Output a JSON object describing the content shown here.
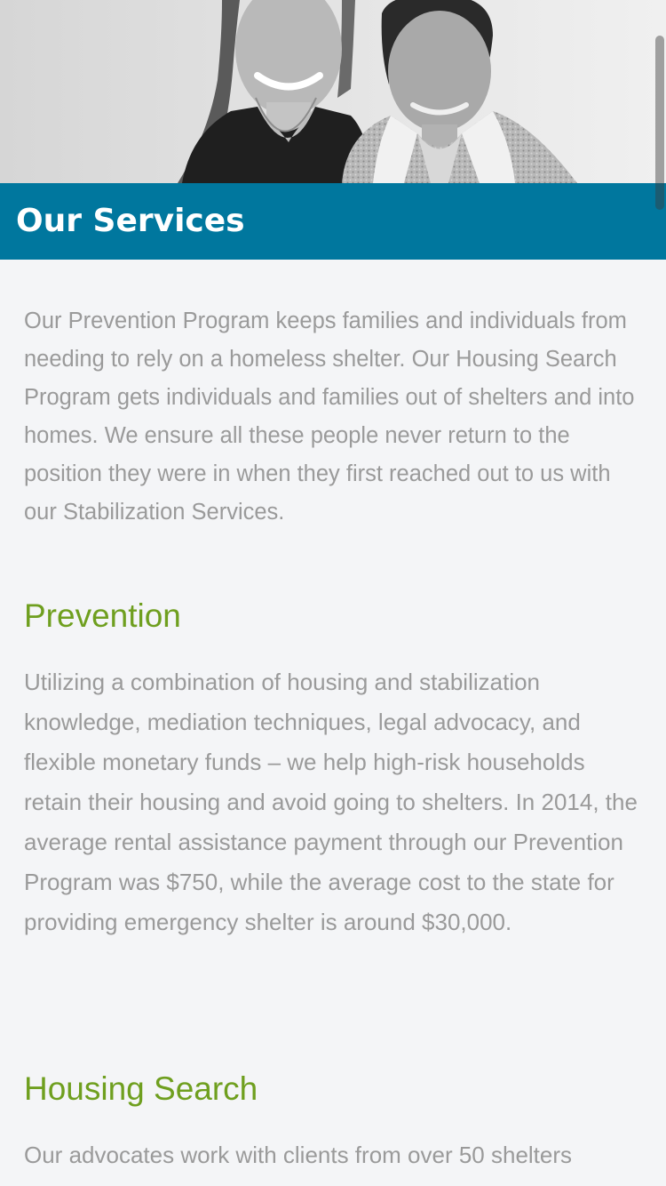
{
  "header": {
    "title": "Our Services"
  },
  "intro": {
    "text": "Our Prevention Program keeps families and individuals from needing to rely on a homeless shelter. Our Housing Search Program gets individuals and families out of shelters and into homes. We ensure all these people never return to the position they were in when they first reached out to us with our Stabilization Services."
  },
  "sections": [
    {
      "heading": "Prevention",
      "text": "Utilizing a combination of housing and stabilization knowledge, mediation techniques, legal advocacy, and flexible monetary funds – we help high-risk households retain their housing and avoid going to shelters. In 2014, the average rental assistance payment through our Prevention Program was $750, while the average cost to the state for providing emergency shelter is around $30,000."
    },
    {
      "heading": "Housing Search",
      "text": "Our advocates work with clients from over 50 shelters"
    }
  ],
  "colors": {
    "title_bar": "#00779e",
    "heading_green": "#6f9f1f",
    "body_text": "#9a9a9a",
    "background": "#f4f5f7"
  }
}
